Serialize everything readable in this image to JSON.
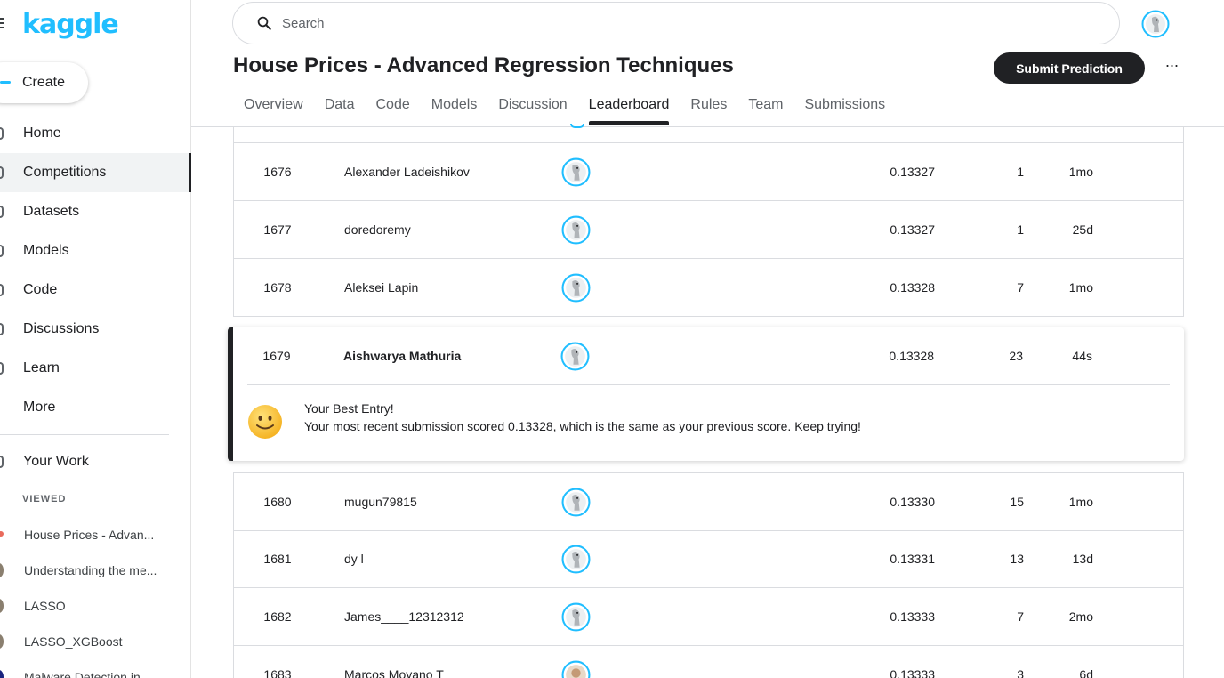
{
  "sidebar": {
    "logo": "kaggle",
    "create_label": "Create",
    "nav": [
      {
        "label": "Home"
      },
      {
        "label": "Competitions",
        "active": true
      },
      {
        "label": "Datasets"
      },
      {
        "label": "Models"
      },
      {
        "label": "Code"
      },
      {
        "label": "Discussions"
      },
      {
        "label": "Learn"
      },
      {
        "label": "More"
      }
    ],
    "your_work": "Your Work",
    "viewed_label": "VIEWED",
    "viewed": [
      "House Prices - Advan...",
      "Understanding the me...",
      "LASSO",
      "LASSO_XGBoost",
      "Malware Detection in..."
    ]
  },
  "header": {
    "search_placeholder": "Search",
    "title": "House Prices - Advanced Regression Techniques",
    "submit_label": "Submit Prediction",
    "more_label": "···",
    "tabs": [
      "Overview",
      "Data",
      "Code",
      "Models",
      "Discussion",
      "Leaderboard",
      "Rules",
      "Team",
      "Submissions"
    ],
    "active_tab": "Leaderboard"
  },
  "leaderboard": {
    "rows_above": [
      {
        "rank": "1676",
        "name": "Alexander Ladeishikov",
        "score": "0.13327",
        "entries": "1",
        "last": "1mo"
      },
      {
        "rank": "1677",
        "name": "doredoremy",
        "score": "0.13327",
        "entries": "1",
        "last": "25d"
      },
      {
        "rank": "1678",
        "name": "Aleksei Lapin",
        "score": "0.13328",
        "entries": "7",
        "last": "1mo"
      }
    ],
    "mine": {
      "rank": "1679",
      "name": "Aishwarya Mathuria",
      "score": "0.13328",
      "entries": "23",
      "last": "44s",
      "message_title": "Your Best Entry!",
      "message_body": "Your most recent submission scored 0.13328, which is the same as your previous score. Keep trying!"
    },
    "rows_below": [
      {
        "rank": "1680",
        "name": "mugun79815",
        "score": "0.13330",
        "entries": "15",
        "last": "1mo"
      },
      {
        "rank": "1681",
        "name": "dy l",
        "score": "0.13331",
        "entries": "13",
        "last": "13d"
      },
      {
        "rank": "1682",
        "name": "James____12312312",
        "score": "0.13333",
        "entries": "7",
        "last": "2mo"
      },
      {
        "rank": "1683",
        "name": "Marcos Moyano T",
        "score": "0.13333",
        "entries": "3",
        "last": "6d"
      }
    ]
  },
  "colors": {
    "brand": "#20BEFF",
    "dark": "#202124",
    "border": "#dadce0"
  }
}
